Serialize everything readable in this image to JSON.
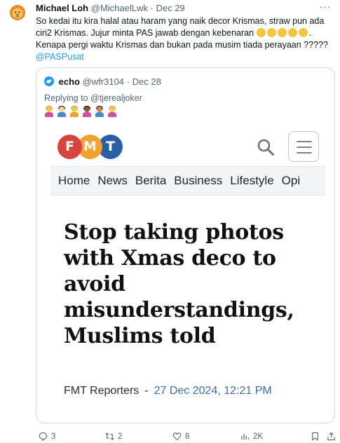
{
  "tweet": {
    "author_name": "Michael Loh",
    "author_handle": "@MichaelLwk",
    "dot": "·",
    "date": "Dec 29",
    "more": "···",
    "text_part1": "So kedai itu kira halal atau haram yang naik decor Krismas, straw pun ada ciri2 Krismas. Jujur minta PAS jawab dengan kebenaran ",
    "text_part2": ". Kenapa pergi waktu Krismas dan bukan pada musim tiada perayaan ?????",
    "mention": "@PASPusat",
    "emojis": [
      "upside-down-face",
      "joy-face",
      "rofl-face",
      "grin-sweat-face",
      "upside-down-face"
    ]
  },
  "quote": {
    "author_name": "echo",
    "author_handle": "@wfr3104",
    "dot": "·",
    "date": "Dec 28",
    "replying_prefix": "Replying to ",
    "replying_to": "@tjerealjoker",
    "emojis": [
      "person-shrugging",
      "man-facepalming",
      "person-shrugging",
      "woman-facepalming",
      "man-facepalming",
      "person-shrugging"
    ]
  },
  "article": {
    "logo_letters": [
      "F",
      "M",
      "T"
    ],
    "nav": [
      "Home",
      "News",
      "Berita",
      "Business",
      "Lifestyle",
      "Opi"
    ],
    "headline": "Stop taking photos with Xmas deco to avoid misunderstandings, Muslims told",
    "byline_author": "FMT Reporters",
    "byline_sep": "-",
    "byline_date": "27 Dec 2024, 12:21 PM"
  },
  "actions": {
    "replies": "3",
    "reposts": "2",
    "likes": "8",
    "views": "2K"
  },
  "colors": {
    "accent": "#1d9bf0",
    "muted": "#536471",
    "fmt_red": "#d4463b",
    "fmt_orange": "#f0a12e",
    "fmt_blue": "#2a5fa5"
  }
}
